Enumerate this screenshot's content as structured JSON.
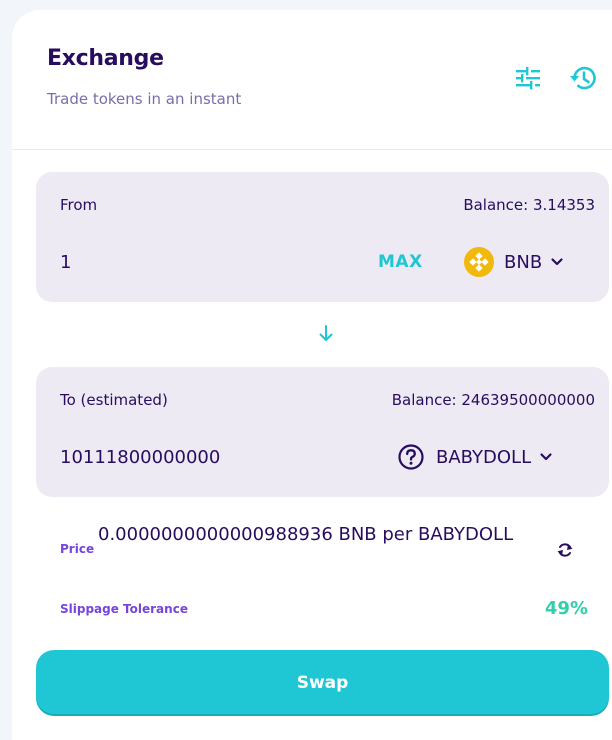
{
  "header": {
    "title": "Exchange",
    "subtitle": "Trade tokens in an instant",
    "settings_icon": "sliders-icon",
    "history_icon": "history-icon"
  },
  "from": {
    "label": "From",
    "balance": "Balance: 3.14353",
    "amount": "1",
    "max_label": "MAX",
    "token": "BNB",
    "token_icon": "bnb-icon"
  },
  "switch_icon": "arrow-down-icon",
  "to": {
    "label": "To (estimated)",
    "balance": "Balance: 24639500000000",
    "amount": "10111800000000",
    "token": "BABYDOLL",
    "token_icon": "question-circle-icon"
  },
  "price": {
    "label": "Price",
    "value": "0.0000000000000988936 BNB per BABYDOLL",
    "refresh_icon": "refresh-icon"
  },
  "slippage": {
    "label": "Slippage Tolerance",
    "value": "49%"
  },
  "swap_label": "Swap",
  "colors": {
    "primary": "#1fc7d4",
    "text": "#280d5f",
    "secondary": "#7645d9",
    "subtle": "#7a6eaa",
    "success": "#31d0aa",
    "panel": "#eeeaf4",
    "bnb": "#f0b90b"
  }
}
